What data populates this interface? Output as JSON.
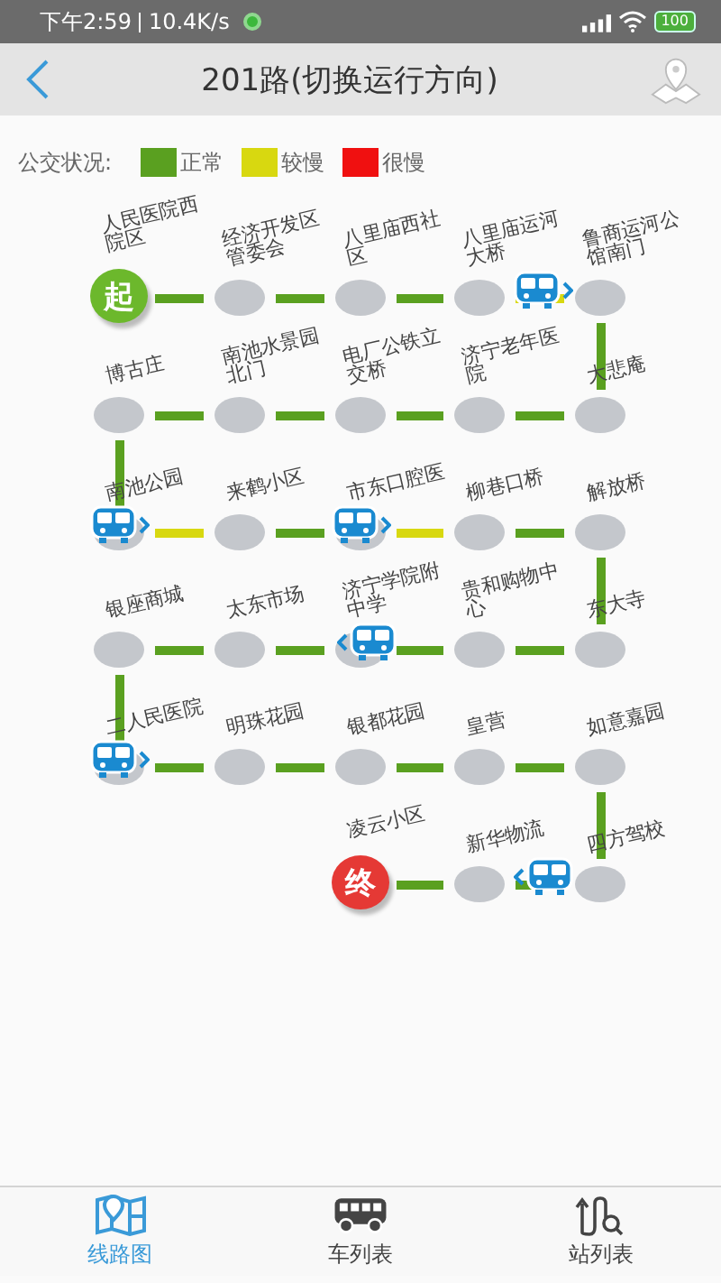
{
  "status_bar": {
    "time": "下午2:59",
    "speed": "10.4K/s",
    "battery": "100"
  },
  "header": {
    "title": "201路(切换运行方向)"
  },
  "legend": {
    "label": "公交状况:",
    "items": [
      {
        "label": "正常",
        "color": "#5aa020"
      },
      {
        "label": "较慢",
        "color": "#d8d810"
      },
      {
        "label": "很慢",
        "color": "#f01010"
      }
    ]
  },
  "stations": [
    {
      "name": "人民医院西院区",
      "kind": "start",
      "marker": "起",
      "bus_at": false,
      "bus_approaching": false
    },
    {
      "name": "经济开发区管委会",
      "kind": "stop",
      "color": "#5aa020",
      "bus_at": false,
      "bus_approaching": false
    },
    {
      "name": "八里庙西社区",
      "kind": "stop",
      "color": "#5aa020",
      "bus_at": false,
      "bus_approaching": false
    },
    {
      "name": "八里庙运河大桥",
      "kind": "stop",
      "color": "#5aa020",
      "bus_at": false,
      "bus_approaching": false
    },
    {
      "name": "鲁商运河公馆南门",
      "kind": "stop",
      "color": "#d8d810",
      "bus_at": false,
      "bus_approaching": true
    },
    {
      "name": "大悲庵",
      "kind": "stop",
      "color": "#5aa020",
      "bus_at": false,
      "bus_approaching": false
    },
    {
      "name": "济宁老年医院",
      "kind": "stop",
      "color": "#5aa020",
      "bus_at": false,
      "bus_approaching": false
    },
    {
      "name": "电厂公铁立交桥",
      "kind": "stop",
      "color": "#5aa020",
      "bus_at": false,
      "bus_approaching": false
    },
    {
      "name": "南池水景园北门",
      "kind": "stop",
      "color": "#5aa020",
      "bus_at": false,
      "bus_approaching": false
    },
    {
      "name": "博古庄",
      "kind": "stop",
      "color": "#5aa020",
      "bus_at": false,
      "bus_approaching": false
    },
    {
      "name": "南池公园",
      "kind": "stop",
      "color": "#5aa020",
      "bus_at": true,
      "bus_approaching": false
    },
    {
      "name": "来鹤小区",
      "kind": "stop",
      "color": "#d8d810",
      "bus_at": false,
      "bus_approaching": false
    },
    {
      "name": "市东口腔医",
      "kind": "stop",
      "color": "#5aa020",
      "bus_at": true,
      "bus_approaching": false
    },
    {
      "name": "柳巷口桥",
      "kind": "stop",
      "color": "#d8d810",
      "bus_at": false,
      "bus_approaching": false
    },
    {
      "name": "解放桥",
      "kind": "stop",
      "color": "#5aa020",
      "bus_at": false,
      "bus_approaching": false
    },
    {
      "name": "东大寺",
      "kind": "stop",
      "color": "#5aa020",
      "bus_at": false,
      "bus_approaching": false
    },
    {
      "name": "贵和购物中心",
      "kind": "stop",
      "color": "#5aa020",
      "bus_at": false,
      "bus_approaching": false
    },
    {
      "name": "济宁学院附中学",
      "kind": "stop",
      "color": "#5aa020",
      "bus_at": true,
      "bus_approaching": false
    },
    {
      "name": "太东市场",
      "kind": "stop",
      "color": "#5aa020",
      "bus_at": false,
      "bus_approaching": false
    },
    {
      "name": "银座商城",
      "kind": "stop",
      "color": "#5aa020",
      "bus_at": false,
      "bus_approaching": false
    },
    {
      "name": "二人民医院",
      "kind": "stop",
      "color": "#5aa020",
      "bus_at": true,
      "bus_approaching": false
    },
    {
      "name": "明珠花园",
      "kind": "stop",
      "color": "#5aa020",
      "bus_at": false,
      "bus_approaching": false
    },
    {
      "name": "银都花园",
      "kind": "stop",
      "color": "#5aa020",
      "bus_at": false,
      "bus_approaching": false
    },
    {
      "name": "皇营",
      "kind": "stop",
      "color": "#5aa020",
      "bus_at": false,
      "bus_approaching": false
    },
    {
      "name": "如意嘉园",
      "kind": "stop",
      "color": "#5aa020",
      "bus_at": false,
      "bus_approaching": false
    },
    {
      "name": "四方驾校",
      "kind": "stop",
      "color": "#5aa020",
      "bus_at": false,
      "bus_approaching": false
    },
    {
      "name": "新华物流",
      "kind": "stop",
      "color": "#5aa020",
      "bus_at": false,
      "bus_approaching": true
    },
    {
      "name": "凌云小区",
      "kind": "end",
      "marker": "终",
      "color": "#5aa020",
      "bus_at": false,
      "bus_approaching": false
    }
  ],
  "tabs": [
    {
      "label": "线路图",
      "selected": true
    },
    {
      "label": "车列表",
      "selected": false
    },
    {
      "label": "站列表",
      "selected": false
    }
  ]
}
